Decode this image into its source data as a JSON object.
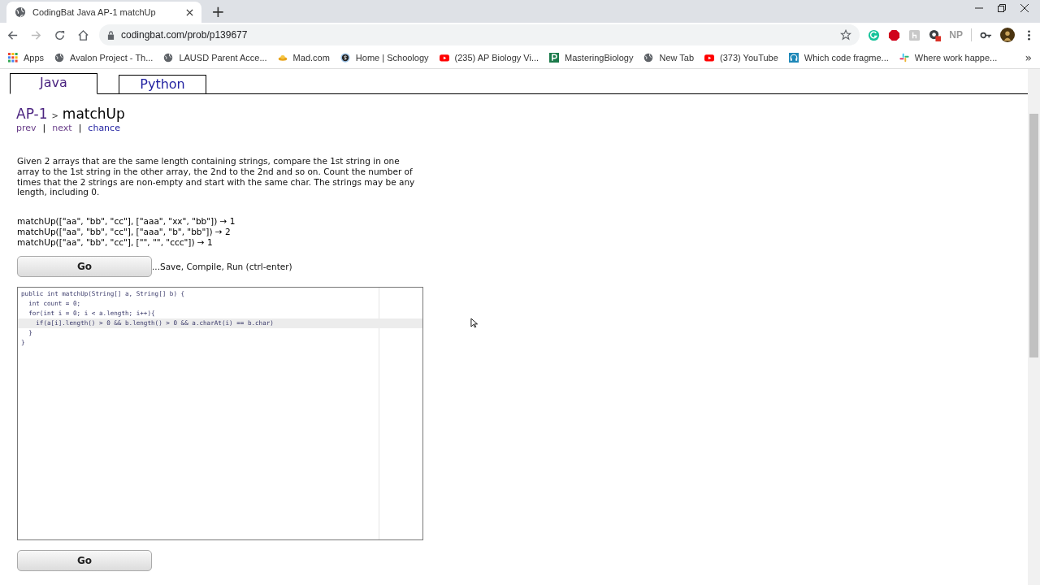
{
  "browser": {
    "tab_title": "CodingBat Java AP-1 matchUp",
    "new_tab": "+",
    "address": "codingbat.com/prob/p139677",
    "extensions": [
      {
        "label": "NP"
      }
    ],
    "bookmarks": [
      {
        "label": "Apps",
        "kind": "apps"
      },
      {
        "label": "Avalon Project - Th...",
        "kind": "globe"
      },
      {
        "label": "LAUSD Parent Acce...",
        "kind": "globe"
      },
      {
        "label": "Mad.com",
        "kind": "saucer"
      },
      {
        "label": "Home | Schoology",
        "kind": "schoology"
      },
      {
        "label": "(235) AP Biology Vi...",
        "kind": "youtube"
      },
      {
        "label": "MasteringBiology",
        "kind": "p"
      },
      {
        "label": "New Tab",
        "kind": "globe"
      },
      {
        "label": "(373) YouTube",
        "kind": "youtube"
      },
      {
        "label": "Which code fragme...",
        "kind": "headset"
      },
      {
        "label": "Where work happe...",
        "kind": "slack"
      }
    ],
    "overflow": "»"
  },
  "page": {
    "tabs": [
      {
        "label": "Java",
        "selected": true
      },
      {
        "label": "Python",
        "selected": false
      }
    ],
    "breadcrumb": {
      "section": "AP-1",
      "separator": ">",
      "problem": "matchUp"
    },
    "nav": [
      {
        "label": "prev",
        "separator": "|"
      },
      {
        "label": "next",
        "separator": "|"
      },
      {
        "label": "chance"
      }
    ],
    "description": "Given 2 arrays that are the same length containing strings, compare the 1st string in one array to the 1st string in the other array, the 2nd to the 2nd and so on. Count the number of times that the 2 strings are non-empty and start with the same char. The strings may be any length, including 0.",
    "examples": [
      "matchUp([\"aa\", \"bb\", \"cc\"], [\"aaa\", \"xx\", \"bb\"]) → 1",
      "matchUp([\"aa\", \"bb\", \"cc\"], [\"aaa\", \"b\", \"bb\"]) → 2",
      "matchUp([\"aa\", \"bb\", \"cc\"], [\"\", \"\", \"ccc\"]) → 1"
    ],
    "go_button": "Go",
    "go_hint": "...Save, Compile, Run (ctrl-enter)",
    "code": [
      {
        "text": "public int matchUp(String[] a, String[] b) {",
        "current": false
      },
      {
        "text": "  int count = 0;",
        "current": false
      },
      {
        "text": "  for(int i = 0; i < a.length; i++){",
        "current": false
      },
      {
        "text": "    if(a[i].length() > 0 && b.length() > 0 && a.charAt(i) == b.char)",
        "current": true
      },
      {
        "text": "  }",
        "current": false
      },
      {
        "text": "}",
        "current": false
      }
    ],
    "go_button_bottom": "Go"
  }
}
